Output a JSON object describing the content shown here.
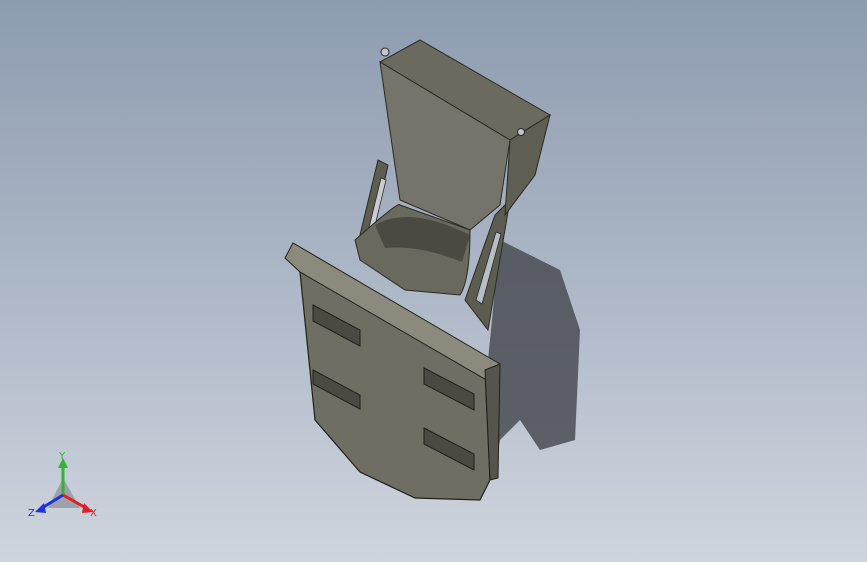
{
  "viewport": {
    "background_top": "#8e9cb0",
    "background_bottom": "#cfd5de",
    "model_color": "#6f6e62",
    "shadow_color": "#3a3c40"
  },
  "triad": {
    "y_label": "Y",
    "x_label": "X",
    "z_label": "Z",
    "y_color": "#2fb52f",
    "x_color": "#e02020",
    "z_color": "#2030e0"
  }
}
